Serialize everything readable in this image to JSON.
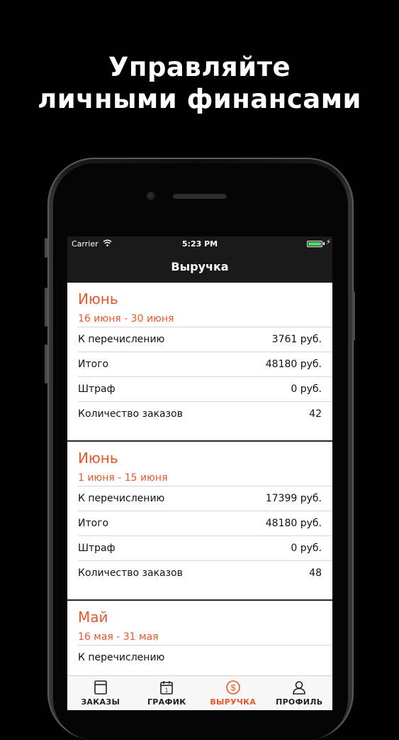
{
  "headline": {
    "line1": "Управляйте",
    "line2": "личными финансами"
  },
  "status_bar": {
    "carrier": "Carrier",
    "time": "5:23 PM",
    "wifi_icon": "wifi-icon",
    "battery_icon": "battery-icon"
  },
  "nav": {
    "title": "Выручка"
  },
  "sections": [
    {
      "title": "Июнь",
      "range": "16 июня - 30 июня",
      "rows": [
        {
          "label": "К перечислению",
          "value": "3761 руб."
        },
        {
          "label": "Итого",
          "value": "48180 руб."
        },
        {
          "label": "Штраф",
          "value": "0 руб."
        },
        {
          "label": "Количество заказов",
          "value": "42"
        }
      ]
    },
    {
      "title": "Июнь",
      "range": "1 июня - 15 июня",
      "rows": [
        {
          "label": "К перечислению",
          "value": "17399 руб."
        },
        {
          "label": "Итого",
          "value": "48180 руб."
        },
        {
          "label": "Штраф",
          "value": "0 руб."
        },
        {
          "label": "Количество заказов",
          "value": "48"
        }
      ]
    },
    {
      "title": "Май",
      "range": "16 мая - 31 мая",
      "rows": [
        {
          "label": "К перечислению",
          "value": ""
        }
      ]
    }
  ],
  "tabs": [
    {
      "label": "ЗАКАЗЫ",
      "icon": "orders-icon",
      "active": false
    },
    {
      "label": "ГРАФИК",
      "icon": "calendar-icon",
      "active": false
    },
    {
      "label": "ВЫРУЧКА",
      "icon": "dollar-icon",
      "active": true
    },
    {
      "label": "ПРОФИЛЬ",
      "icon": "profile-icon",
      "active": false
    }
  ],
  "colors": {
    "accent": "#e8582a",
    "bar": "#1a1a1a",
    "background": "#000000",
    "battery": "#4cd964"
  }
}
